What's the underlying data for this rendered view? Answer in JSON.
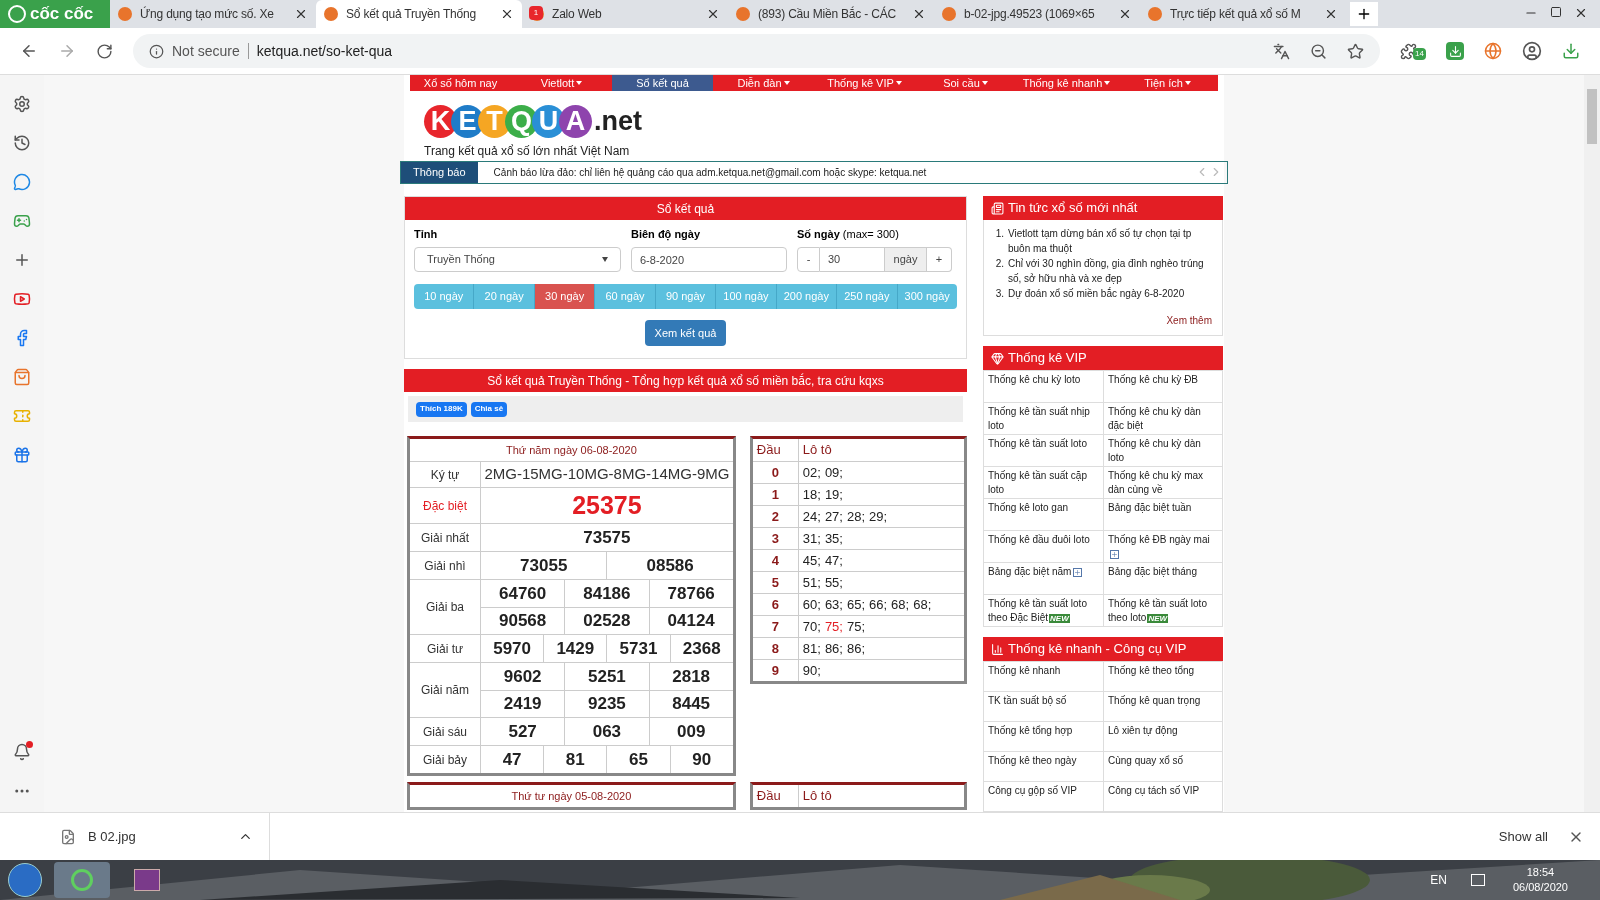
{
  "browser": {
    "brand": "cốc cốc",
    "tabs": [
      {
        "title": "Ứng dụng tạo mức số. Xe",
        "selected": false
      },
      {
        "title": "Sổ kết quả Truyền Thống",
        "selected": true
      },
      {
        "title": "Zalo Web",
        "selected": false,
        "badge": "1"
      },
      {
        "title": "(893) Cầu Miền Bắc - CÁC",
        "selected": false
      },
      {
        "title": "b-02-jpg.49523 (1069×65",
        "selected": false
      },
      {
        "title": "Trực tiếp kết quả xổ số M",
        "selected": false
      }
    ],
    "security": "Not secure",
    "url": "ketqua.net/so-ket-qua",
    "extension_badge": "14"
  },
  "nav": [
    {
      "label": "Xổ số hôm nay",
      "dropdown": false,
      "selected": false
    },
    {
      "label": "Vietlott",
      "dropdown": true,
      "selected": false
    },
    {
      "label": "Sổ kết quả",
      "dropdown": false,
      "selected": true
    },
    {
      "label": "Diễn đàn",
      "dropdown": true,
      "selected": false
    },
    {
      "label": "Thống kê VIP",
      "dropdown": true,
      "selected": false
    },
    {
      "label": "Soi cầu",
      "dropdown": true,
      "selected": false
    },
    {
      "label": "Thống kê nhanh",
      "dropdown": true,
      "selected": false
    },
    {
      "label": "Tiện ích",
      "dropdown": true,
      "selected": false
    }
  ],
  "logo": {
    "letters": [
      {
        "char": "K",
        "color": "#e8262c"
      },
      {
        "char": "E",
        "color": "#1f7cc8"
      },
      {
        "char": "T",
        "color": "#f5a623"
      },
      {
        "char": "Q",
        "color": "#3cae49"
      },
      {
        "char": "U",
        "color": "#2a8fd6"
      },
      {
        "char": "A",
        "color": "#8e44ad"
      }
    ],
    "suffix": ".net",
    "tagline": "Trang kết quả xổ số lớn nhất Việt Nam"
  },
  "notice": {
    "label": "Thông báo",
    "text": "Cảnh báo lừa đảo: chỉ liên hệ quảng cáo qua adm.ketqua.net@gmail.com hoặc skype: ketqua.net"
  },
  "search": {
    "title": "Sổ kết quả",
    "province_label": "Tỉnh",
    "province": "Truyền Thống",
    "date_label": "Biên độ ngày",
    "date": "6-8-2020",
    "days_label": "Số ngày",
    "days_hint": "(max= 300)",
    "minus": "-",
    "days": "30",
    "unit": "ngày",
    "plus": "+",
    "presets": [
      {
        "label": "10 ngày",
        "selected": false
      },
      {
        "label": "20 ngày",
        "selected": false
      },
      {
        "label": "30 ngày",
        "selected": true
      },
      {
        "label": "60 ngày",
        "selected": false
      },
      {
        "label": "90 ngày",
        "selected": false
      },
      {
        "label": "100 ngày",
        "selected": false
      },
      {
        "label": "200 ngày",
        "selected": false
      },
      {
        "label": "250 ngày",
        "selected": false
      },
      {
        "label": "300 ngày",
        "selected": false
      }
    ],
    "submit": "Xem kết quả"
  },
  "results": {
    "title": "Sổ kết quả Truyền Thống - Tổng hợp kết quả xổ số miền bắc, tra cứu kqxs",
    "like": "Thích 189K",
    "share": "Chia sẻ",
    "draws": [
      {
        "date": "Thứ năm ngày 06-08-2020",
        "rows": [
          {
            "label": "Ký tự",
            "kind": "code",
            "lines": [
              [
                "2MG-15MG-10MG-8MG-14MG-9MG"
              ]
            ]
          },
          {
            "label": "Đặc biệt",
            "kind": "special",
            "lines": [
              [
                "25375"
              ]
            ]
          },
          {
            "label": "Giải nhất",
            "kind": "normal",
            "lines": [
              [
                "73575"
              ]
            ]
          },
          {
            "label": "Giải nhì",
            "kind": "normal",
            "lines": [
              [
                "73055",
                "08586"
              ]
            ]
          },
          {
            "label": "Giải ba",
            "kind": "normal",
            "lines": [
              [
                "64760",
                "84186",
                "78766"
              ],
              [
                "90568",
                "02528",
                "04124"
              ]
            ]
          },
          {
            "label": "Giải tư",
            "kind": "normal",
            "lines": [
              [
                "5970",
                "1429",
                "5731",
                "2368"
              ]
            ]
          },
          {
            "label": "Giải năm",
            "kind": "normal",
            "lines": [
              [
                "9602",
                "5251",
                "2818"
              ],
              [
                "2419",
                "9235",
                "8445"
              ]
            ]
          },
          {
            "label": "Giải sáu",
            "kind": "normal",
            "lines": [
              [
                "527",
                "063",
                "009"
              ]
            ]
          },
          {
            "label": "Giải bảy",
            "kind": "normal",
            "lines": [
              [
                "47",
                "81",
                "65",
                "90"
              ]
            ]
          }
        ],
        "loto_head": "Đầu",
        "loto_title": "Lô tô",
        "loto": [
          {
            "head": "0",
            "nums": [
              {
                "n": "02;",
                "hit": false
              },
              {
                "n": "09;",
                "hit": false
              }
            ]
          },
          {
            "head": "1",
            "nums": [
              {
                "n": "18;",
                "hit": false
              },
              {
                "n": "19;",
                "hit": false
              }
            ]
          },
          {
            "head": "2",
            "nums": [
              {
                "n": "24;",
                "hit": false
              },
              {
                "n": "27;",
                "hit": false
              },
              {
                "n": "28;",
                "hit": false
              },
              {
                "n": "29;",
                "hit": false
              }
            ]
          },
          {
            "head": "3",
            "nums": [
              {
                "n": "31;",
                "hit": false
              },
              {
                "n": "35;",
                "hit": false
              }
            ]
          },
          {
            "head": "4",
            "nums": [
              {
                "n": "45;",
                "hit": false
              },
              {
                "n": "47;",
                "hit": false
              }
            ]
          },
          {
            "head": "5",
            "nums": [
              {
                "n": "51;",
                "hit": false
              },
              {
                "n": "55;",
                "hit": false
              }
            ]
          },
          {
            "head": "6",
            "nums": [
              {
                "n": "60;",
                "hit": false
              },
              {
                "n": "63;",
                "hit": false
              },
              {
                "n": "65;",
                "hit": false
              },
              {
                "n": "66;",
                "hit": false
              },
              {
                "n": "68;",
                "hit": false
              },
              {
                "n": "68;",
                "hit": false
              }
            ]
          },
          {
            "head": "7",
            "nums": [
              {
                "n": "70;",
                "hit": false
              },
              {
                "n": "75;",
                "hit": true
              },
              {
                "n": "75;",
                "hit": false
              }
            ]
          },
          {
            "head": "8",
            "nums": [
              {
                "n": "81;",
                "hit": false
              },
              {
                "n": "86;",
                "hit": false
              },
              {
                "n": "86;",
                "hit": false
              }
            ]
          },
          {
            "head": "9",
            "nums": [
              {
                "n": "90;",
                "hit": false
              }
            ]
          }
        ]
      },
      {
        "date": "Thứ tư ngày 05-08-2020",
        "loto_head": "Đầu",
        "loto_title": "Lô tô"
      }
    ]
  },
  "news": {
    "title": "Tin tức xổ số mới nhất",
    "items": [
      {
        "marker": "1.",
        "text": "Vietlott tạm dừng bán xổ số tự chọn tại tp buôn ma thuột"
      },
      {
        "marker": "2.",
        "text": "Chỉ với 30 nghìn đồng, gia đình nghèo trúng số, sở hữu nhà và xe đẹp"
      },
      {
        "marker": "3.",
        "text": "Dự đoán xổ số miền bắc ngày 6-8-2020"
      }
    ],
    "more": "Xem thêm"
  },
  "vip": {
    "title": "Thống kê VIP",
    "links": [
      {
        "text": "Thống kê chu kỳ loto"
      },
      {
        "text": "Thống kê chu kỳ ĐB"
      },
      {
        "text": "Thống kê tần suất nhịp loto"
      },
      {
        "text": "Thống kê chu kỳ dàn đặc biệt"
      },
      {
        "text": "Thống kê tần suất loto"
      },
      {
        "text": "Thống kê chu kỳ dàn loto"
      },
      {
        "text": "Thống kê tần suất cặp loto"
      },
      {
        "text": "Thống kê chu kỳ max dàn cùng về"
      },
      {
        "text": "Thống kê loto gan"
      },
      {
        "text": "Bảng đặc biệt tuần"
      },
      {
        "text": "Thống kê đầu đuôi loto"
      },
      {
        "text": "Thống kê ĐB ngày mai",
        "tag": {
          "kind": "plus"
        }
      },
      {
        "text": "Bảng đặc biệt năm",
        "tag": {
          "kind": "plus"
        }
      },
      {
        "text": "Bảng đặc biệt tháng"
      },
      {
        "text": "Thống kê tần suất loto theo Đặc Biệt",
        "tag": {
          "kind": "new",
          "label": "NEW"
        }
      },
      {
        "text": "Thống kê tần suất loto theo loto",
        "tag": {
          "kind": "new",
          "label": "NEW"
        }
      }
    ]
  },
  "tools": {
    "title": "Thống kê nhanh - Công cụ VIP",
    "links": [
      {
        "text": "Thống kê nhanh"
      },
      {
        "text": "Thống kê theo tổng"
      },
      {
        "text": "TK tần suất bộ số"
      },
      {
        "text": "Thống kê quan trọng"
      },
      {
        "text": "Thống kê tổng hợp"
      },
      {
        "text": "Lô xiên tự động"
      },
      {
        "text": "Thống kê theo ngày"
      },
      {
        "text": "Cùng quay xổ số"
      },
      {
        "text": "Công cụ gộp số VIP"
      },
      {
        "text": "Công cụ tách số VIP"
      }
    ]
  },
  "downloads": {
    "file": "B 02.jpg",
    "show_all": "Show all"
  },
  "taskbar": {
    "language": "EN",
    "time": "18:54",
    "date": "06/08/2020"
  }
}
